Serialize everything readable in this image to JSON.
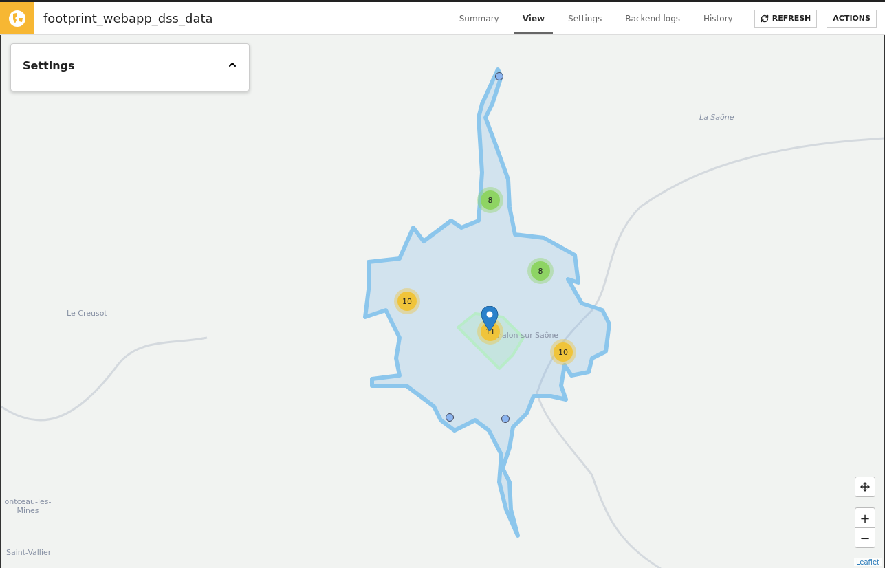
{
  "header": {
    "title": "footprint_webapp_dss_data"
  },
  "tabs": [
    {
      "label": "Summary",
      "selected": false
    },
    {
      "label": "View",
      "selected": true
    },
    {
      "label": "Settings",
      "selected": false
    },
    {
      "label": "Backend logs",
      "selected": false
    },
    {
      "label": "History",
      "selected": false
    }
  ],
  "buttons": [
    {
      "label": "REFRESH",
      "kind": "refresh"
    },
    {
      "label": "ACTIONS",
      "kind": "plain"
    }
  ],
  "settings_panel": {
    "title": "Settings",
    "expanded": true
  },
  "map": {
    "labels": [
      {
        "text": "La Saône",
        "kind": "river"
      },
      {
        "text": "Le Creusot",
        "kind": "town"
      },
      {
        "text": "halon-sur-Saône",
        "kind": "town"
      },
      {
        "text": "ontceau-les-Mines",
        "kind": "town"
      },
      {
        "text": "Saint-Vallier",
        "kind": "town"
      }
    ],
    "clusters": [
      {
        "count": "8",
        "color": "#8ed463"
      },
      {
        "count": "8",
        "color": "#8ed463"
      },
      {
        "count": "10",
        "color": "#f0c43a"
      },
      {
        "count": "11",
        "color": "#f0c43a"
      },
      {
        "count": "10",
        "color": "#f0c43a"
      }
    ],
    "zoom_in": "+",
    "zoom_out": "−",
    "attribution": "Leaflet"
  }
}
